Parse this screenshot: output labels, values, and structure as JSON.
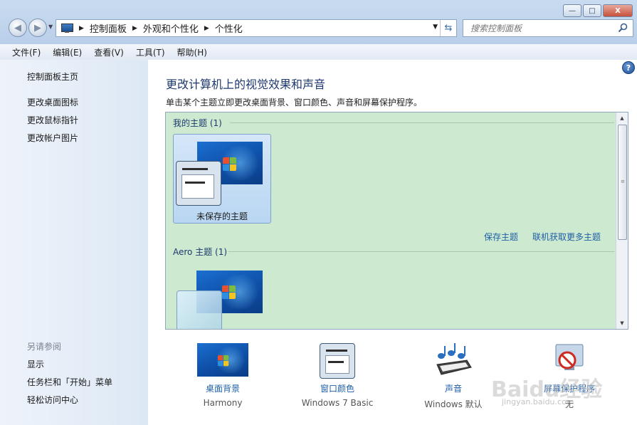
{
  "window": {
    "controls": {
      "minimize": "—",
      "maximize": "□",
      "close": "X"
    }
  },
  "nav": {
    "back_icon": "back-arrow-icon",
    "forward_icon": "forward-arrow-icon"
  },
  "address": {
    "crumbs": [
      "控制面板",
      "外观和个性化",
      "个性化"
    ]
  },
  "search": {
    "placeholder": "搜索控制面板"
  },
  "menu": [
    "文件(F)",
    "编辑(E)",
    "查看(V)",
    "工具(T)",
    "帮助(H)"
  ],
  "sidebar": {
    "home": "控制面板主页",
    "links": [
      "更改桌面图标",
      "更改鼠标指针",
      "更改帐户图片"
    ],
    "see_also_title": "另请参阅",
    "see_also": [
      "显示",
      "任务栏和「开始」菜单",
      "轻松访问中心"
    ]
  },
  "main": {
    "title": "更改计算机上的视觉效果和声音",
    "subtitle": "单击某个主题立即更改桌面背景、窗口颜色、声音和屏幕保护程序。",
    "help": "?"
  },
  "themes": {
    "my_group": "我的主题 (1)",
    "unsaved_label": "未保存的主题",
    "save_link": "保存主题",
    "online_link": "联机获取更多主题",
    "aero_group": "Aero 主题 (1)"
  },
  "bottom": [
    {
      "label": "桌面背景",
      "value": "Harmony"
    },
    {
      "label": "窗口颜色",
      "value": "Windows 7 Basic"
    },
    {
      "label": "声音",
      "value": "Windows 默认"
    },
    {
      "label": "屏幕保护程序",
      "value": "无"
    }
  ],
  "watermark": {
    "brand": "Baidu经验",
    "url": "jingyan.baidu.com"
  },
  "colors": {
    "theme_bg": "#cde9cf",
    "link": "#1f5fa8",
    "heading": "#1e3a6e"
  }
}
